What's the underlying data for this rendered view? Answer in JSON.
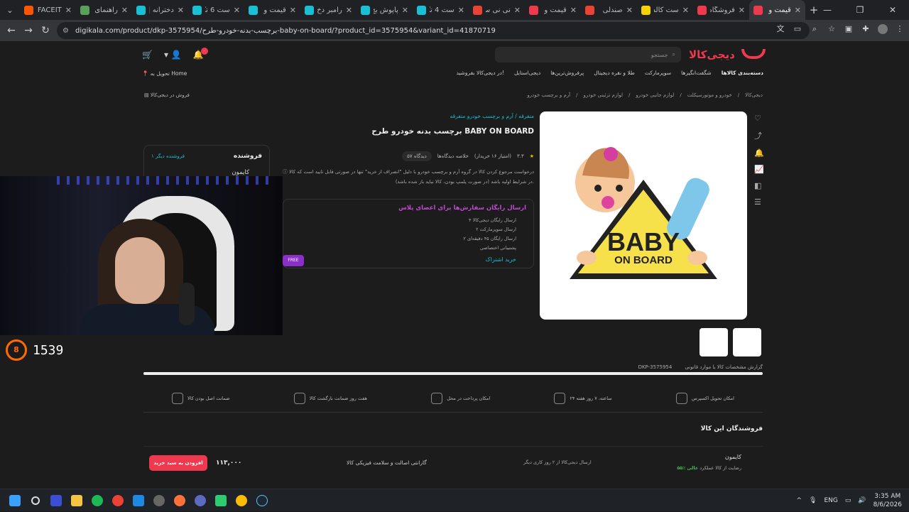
{
  "tabs": [
    {
      "title": "FACEIT",
      "color": "#ff5500"
    },
    {
      "title": "راهنمای",
      "color": "#5aa05a"
    },
    {
      "title": "دخترانه |",
      "color": "#19bfd3"
    },
    {
      "title": "ست 6 تک",
      "color": "#19bfd3"
    },
    {
      "title": "قیمت و",
      "color": "#19bfd3"
    },
    {
      "title": "رامبر دخ",
      "color": "#19bfd3"
    },
    {
      "title": "پاپوش بچ",
      "color": "#19bfd3"
    },
    {
      "title": "ست 4 تک",
      "color": "#19bfd3"
    },
    {
      "title": "نی نی س",
      "color": "#ea4335"
    },
    {
      "title": "قیمت و",
      "color": "#ef394e"
    },
    {
      "title": "صندلی",
      "color": "#ea4335"
    },
    {
      "title": "ست کالس",
      "color": "#f6d200"
    },
    {
      "title": "فروشگاه",
      "color": "#ef394e"
    },
    {
      "title": "قیمت و",
      "color": "#ef394e",
      "active": true
    }
  ],
  "url": "digikala.com/product/dkp-3575954/برچسب-بدنه-خودرو-طرح-baby-on-board/?product_id=3575954&variant_id=41870719",
  "header": {
    "logo": "دیجی‌کالا",
    "search_placeholder": "جستجو",
    "cart_count": "۰",
    "deliver_to": "تحویل به Home"
  },
  "catnav": [
    "دسته‌بندی کالاها",
    "شگفت‌انگیزها",
    "سوپرمارکت",
    "طلا و نقره دیجیتال",
    "پرفروش‌ترین‌ها",
    "دیجی‌استایل",
    "در دیجی‌کالا بفروشید!"
  ],
  "breadcrumb": [
    "دیجی‌کالا",
    "خودرو و موتورسیکلت",
    "لوازم جانبی خودرو",
    "لوازم تزئینی خودرو",
    "آرم و برچسب خودرو"
  ],
  "sell_link": "فروش در دیجی‌کالا",
  "product": {
    "category": "متفرقه / آرم و برچسب خودرو متفرقه",
    "title": "برچسب بدنه خودرو طرح BABY ON BOARD",
    "rating": "۳.۳",
    "rating_count": "(امتیاز ۱۶ خریدار)",
    "reviews": "خلاصه دیدگاه‌ها",
    "views": "۵۷ دیدگاه",
    "notice": "درخواست مرجوع کردن کالا در گروه آرم و برچسب خودرو با دلیل \"انصراف از خرید\" تنها در صورتی قابل تایید است که کالا در شرایط اولیه باشد (در صورت پلمپ بودن، کالا نباید باز شده باشد).",
    "sticker_line1": "BABY",
    "sticker_line2": "ON BOARD"
  },
  "plus": {
    "heading": "ارسال رایگان سفارش‌ها برای اعضای پلاس",
    "items": [
      "۴ ارسال رایگان دیجی‌کالا",
      "۲ ارسال سوپرمارکت",
      "۲ ارسال رایگان ۴۵ دقیقه‌ای",
      "پشتیبانی اختصاصی"
    ],
    "subscribe": "خرید اشتراک",
    "badge": "FREE"
  },
  "seller": {
    "heading": "فروشنده",
    "others": "۱ فروشنده دیگر",
    "name": "کایمون"
  },
  "spec": {
    "report": "گزارش مشخصات کالا یا موارد قانونی",
    "code": "DKP-3575954"
  },
  "features": [
    "امکان تحویل اکسپرس",
    "۲۴ ساعته، ۷ روز هفته",
    "امکان پرداخت در محل",
    "هفت روز ضمانت بازگشت کالا",
    "ضمانت اصل بودن کالا"
  ],
  "sellers_section": {
    "heading": "فروشندگان این کالا",
    "name": "کایمون",
    "satisfaction_label": "رضایت از کالا",
    "satisfaction": "۵۵٪",
    "performance_label": "عملکرد",
    "performance": "عالی",
    "ship": "ارسال دیجی‌کالا از ۲ روز کاری دیگر",
    "guarantee": "گارانتی اصالت و سلامت فیزیکی کالا",
    "price": "۱۱۳,۰۰۰",
    "add": "افزودن به سبد خرید"
  },
  "overlay": {
    "level": "8",
    "elo": "1539"
  },
  "tray": {
    "lang": "ENG",
    "time": "3:35 AM",
    "date": "8/6/2026"
  }
}
